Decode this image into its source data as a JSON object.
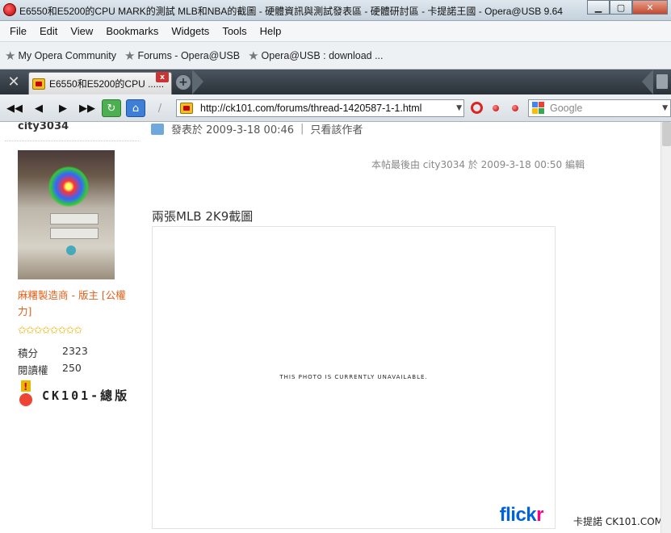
{
  "window": {
    "title": "E6550和E5200的CPU MARK的測試 MLB和NBA的截圖 - 硬體資訊與測試發表區 - 硬體研討區 - 卡提諾王國 - Opera@USB 9.64",
    "min": "▁",
    "max": "▢",
    "close": "✕"
  },
  "menu": [
    "File",
    "Edit",
    "View",
    "Bookmarks",
    "Widgets",
    "Tools",
    "Help"
  ],
  "bookmarks": [
    "My Opera Community",
    "Forums - Opera@USB",
    "Opera@USB : download ..."
  ],
  "tab": {
    "label": "E6550和E5200的CPU ......",
    "close": "x"
  },
  "address": {
    "url": "http://ck101.com/forums/thread-1420587-1-1.html"
  },
  "search": {
    "placeholder": "Google"
  },
  "post": {
    "username": "city3034",
    "meta_posted": "發表於 2009-3-18 00:46",
    "meta_sep": "|",
    "meta_author_only": "只看該作者",
    "edited_note": "本帖最後由 city3034 於 2009-3-18 00:50 編輯",
    "heading": "兩張MLB 2K9截圖",
    "photo_message": "This photo is currently unavailable.",
    "flickr_a": "flick",
    "flickr_b": "r"
  },
  "user": {
    "title": "麻糬製造商 - 版主 [公權力]",
    "stars": "✩✩✩✩✩✩✩✩",
    "stats": [
      {
        "label": "積分",
        "value": "2323"
      },
      {
        "label": "閱讀權",
        "value": "250"
      }
    ],
    "medal_text": "CK101-總版"
  },
  "watermark": "卡提諾 CK101.COM",
  "colors": {
    "accent_orange": "#e0601a",
    "flickr_blue": "#0063dc",
    "flickr_pink": "#ff0084"
  }
}
